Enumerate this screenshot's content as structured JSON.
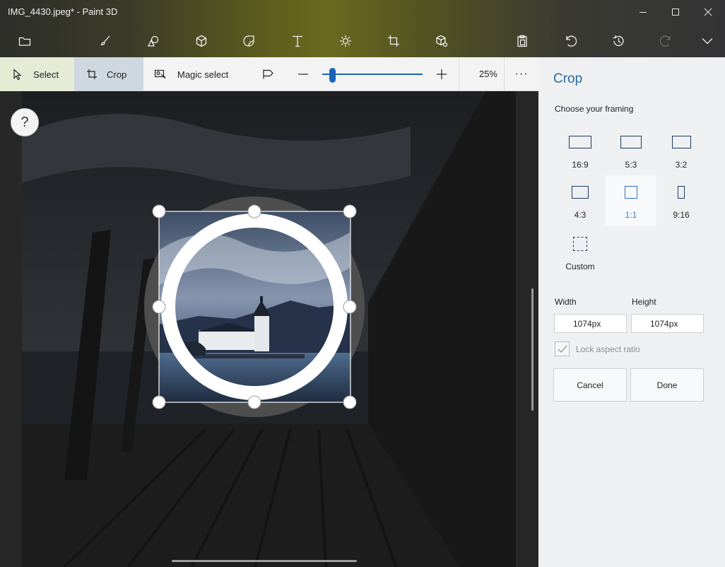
{
  "window": {
    "title": "IMG_4430.jpeg* - Paint 3D",
    "controls": [
      "minimize-icon",
      "maximize-icon",
      "close-icon"
    ]
  },
  "main_toolbar": {
    "left_tools": [
      "folder-icon",
      "brush-icon",
      "2d-shapes-icon",
      "3d-shapes-icon",
      "stickers-icon",
      "text-icon",
      "effects-icon",
      "canvas-icon",
      "3d-library-icon"
    ],
    "right_tools": [
      "paste-icon",
      "undo-icon",
      "history-icon",
      "redo-icon",
      "expand-chevron-icon"
    ]
  },
  "sub_toolbar": {
    "select_label": "Select",
    "crop_label": "Crop",
    "magic_select_label": "Magic select",
    "zoom_value": "25%",
    "zoom_level": 0.1,
    "more_label": "···"
  },
  "canvas": {
    "help_label": "?"
  },
  "crop_panel": {
    "title": "Crop",
    "framing_label": "Choose your framing",
    "framing_options": [
      {
        "label": "16:9",
        "icon": "ratio-16-9-icon"
      },
      {
        "label": "5:3",
        "icon": "ratio-5-3-icon"
      },
      {
        "label": "3:2",
        "icon": "ratio-3-2-icon"
      },
      {
        "label": "4:3",
        "icon": "ratio-4-3-icon"
      },
      {
        "label": "1:1",
        "icon": "ratio-1-1-icon",
        "selected": true
      },
      {
        "label": "9:16",
        "icon": "ratio-9-16-icon"
      },
      {
        "label": "Custom",
        "icon": "custom-ratio-icon"
      }
    ],
    "width_label": "Width",
    "height_label": "Height",
    "width_value": "1074px",
    "height_value": "1074px",
    "lock_label": "Lock aspect ratio",
    "lock_checked": true,
    "cancel_label": "Cancel",
    "done_label": "Done"
  },
  "colors": {
    "accent": "#1a62b8",
    "panel_title": "#2a6aa7",
    "selected_tool_bg": "#cfd8e1"
  }
}
